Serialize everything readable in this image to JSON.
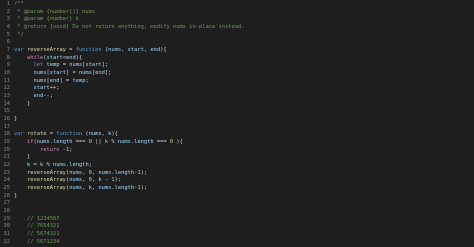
{
  "editor": {
    "lines": [
      {
        "n": "1",
        "tokens": [
          {
            "t": "/**",
            "c": "c"
          }
        ]
      },
      {
        "n": "2",
        "tokens": [
          {
            "t": " * @param {number[]} nums",
            "c": "c"
          }
        ]
      },
      {
        "n": "3",
        "tokens": [
          {
            "t": " * @param {number} k",
            "c": "c"
          }
        ]
      },
      {
        "n": "4",
        "tokens": [
          {
            "t": " * @return {void} Do not return anything, modify nums in-place instead.",
            "c": "c"
          }
        ]
      },
      {
        "n": "5",
        "tokens": [
          {
            "t": " */",
            "c": "c"
          }
        ]
      },
      {
        "n": "6",
        "tokens": []
      },
      {
        "n": "7",
        "tokens": [
          {
            "t": "var ",
            "c": "kw"
          },
          {
            "t": "reverseArray",
            "c": "fn"
          },
          {
            "t": " = ",
            "c": "op"
          },
          {
            "t": "function",
            "c": "kw"
          },
          {
            "t": " (",
            "c": "op"
          },
          {
            "t": "nums",
            "c": "va"
          },
          {
            "t": ", ",
            "c": "op"
          },
          {
            "t": "start",
            "c": "va"
          },
          {
            "t": ", ",
            "c": "op"
          },
          {
            "t": "end",
            "c": "va"
          },
          {
            "t": "){",
            "c": "op"
          }
        ]
      },
      {
        "n": "8",
        "tokens": [
          {
            "t": "    ",
            "c": "op"
          },
          {
            "t": "while",
            "c": "pr"
          },
          {
            "t": "(",
            "c": "op"
          },
          {
            "t": "start",
            "c": "va"
          },
          {
            "t": "<",
            "c": "op"
          },
          {
            "t": "end",
            "c": "va"
          },
          {
            "t": "){",
            "c": "op"
          }
        ]
      },
      {
        "n": "9",
        "tokens": [
          {
            "t": "      ",
            "c": "op"
          },
          {
            "t": "let ",
            "c": "kw"
          },
          {
            "t": "temp",
            "c": "va"
          },
          {
            "t": " = ",
            "c": "op"
          },
          {
            "t": "nums",
            "c": "va"
          },
          {
            "t": "[",
            "c": "op"
          },
          {
            "t": "start",
            "c": "va"
          },
          {
            "t": "];",
            "c": "op"
          }
        ]
      },
      {
        "n": "10",
        "tokens": [
          {
            "t": "      ",
            "c": "op"
          },
          {
            "t": "nums",
            "c": "va"
          },
          {
            "t": "[",
            "c": "op"
          },
          {
            "t": "start",
            "c": "va"
          },
          {
            "t": "] = ",
            "c": "op"
          },
          {
            "t": "nums",
            "c": "va"
          },
          {
            "t": "[",
            "c": "op"
          },
          {
            "t": "end",
            "c": "va"
          },
          {
            "t": "];",
            "c": "op"
          }
        ]
      },
      {
        "n": "11",
        "tokens": [
          {
            "t": "      ",
            "c": "op"
          },
          {
            "t": "nums",
            "c": "va"
          },
          {
            "t": "[",
            "c": "op"
          },
          {
            "t": "end",
            "c": "va"
          },
          {
            "t": "] = ",
            "c": "op"
          },
          {
            "t": "temp",
            "c": "va"
          },
          {
            "t": ";",
            "c": "op"
          }
        ]
      },
      {
        "n": "12",
        "tokens": [
          {
            "t": "      ",
            "c": "op"
          },
          {
            "t": "start",
            "c": "va"
          },
          {
            "t": "++;",
            "c": "op"
          }
        ]
      },
      {
        "n": "13",
        "tokens": [
          {
            "t": "      ",
            "c": "op"
          },
          {
            "t": "end",
            "c": "va"
          },
          {
            "t": "--;",
            "c": "op"
          }
        ]
      },
      {
        "n": "14",
        "tokens": [
          {
            "t": "    }",
            "c": "op"
          }
        ]
      },
      {
        "n": "15",
        "tokens": []
      },
      {
        "n": "16",
        "tokens": [
          {
            "t": "}",
            "c": "op"
          }
        ]
      },
      {
        "n": "17",
        "tokens": []
      },
      {
        "n": "18",
        "tokens": [
          {
            "t": "var ",
            "c": "kw"
          },
          {
            "t": "rotate",
            "c": "fn"
          },
          {
            "t": " = ",
            "c": "op"
          },
          {
            "t": "function",
            "c": "kw"
          },
          {
            "t": " (",
            "c": "op"
          },
          {
            "t": "nums",
            "c": "va"
          },
          {
            "t": ", ",
            "c": "op"
          },
          {
            "t": "k",
            "c": "va"
          },
          {
            "t": "){",
            "c": "op"
          }
        ]
      },
      {
        "n": "19",
        "tokens": [
          {
            "t": "    ",
            "c": "op"
          },
          {
            "t": "if",
            "c": "pr"
          },
          {
            "t": "(",
            "c": "op"
          },
          {
            "t": "nums",
            "c": "va"
          },
          {
            "t": ".",
            "c": "op"
          },
          {
            "t": "length",
            "c": "va"
          },
          {
            "t": " === ",
            "c": "op"
          },
          {
            "t": "0",
            "c": "nu"
          },
          {
            "t": " || ",
            "c": "op"
          },
          {
            "t": "k",
            "c": "va"
          },
          {
            "t": " % ",
            "c": "op"
          },
          {
            "t": "nums",
            "c": "va"
          },
          {
            "t": ".",
            "c": "op"
          },
          {
            "t": "length",
            "c": "va"
          },
          {
            "t": " === ",
            "c": "op"
          },
          {
            "t": "0",
            "c": "nu"
          },
          {
            "t": " ){",
            "c": "op"
          }
        ]
      },
      {
        "n": "20",
        "tokens": [
          {
            "t": "        ",
            "c": "op"
          },
          {
            "t": "return",
            "c": "pr"
          },
          {
            "t": " -",
            "c": "op"
          },
          {
            "t": "1",
            "c": "nu"
          },
          {
            "t": ";",
            "c": "op"
          }
        ]
      },
      {
        "n": "21",
        "tokens": [
          {
            "t": "    }",
            "c": "op"
          }
        ]
      },
      {
        "n": "22",
        "tokens": [
          {
            "t": "    ",
            "c": "op"
          },
          {
            "t": "k",
            "c": "va"
          },
          {
            "t": " = ",
            "c": "op"
          },
          {
            "t": "k",
            "c": "va"
          },
          {
            "t": " % ",
            "c": "op"
          },
          {
            "t": "nums",
            "c": "va"
          },
          {
            "t": ".",
            "c": "op"
          },
          {
            "t": "length",
            "c": "va"
          },
          {
            "t": ";",
            "c": "op"
          }
        ]
      },
      {
        "n": "23",
        "tokens": [
          {
            "t": "    ",
            "c": "op"
          },
          {
            "t": "reverseArray",
            "c": "fn"
          },
          {
            "t": "(",
            "c": "op"
          },
          {
            "t": "nums",
            "c": "va"
          },
          {
            "t": ", ",
            "c": "op"
          },
          {
            "t": "0",
            "c": "nu"
          },
          {
            "t": ", ",
            "c": "op"
          },
          {
            "t": "nums",
            "c": "va"
          },
          {
            "t": ".",
            "c": "op"
          },
          {
            "t": "length",
            "c": "va"
          },
          {
            "t": "-",
            "c": "op"
          },
          {
            "t": "1",
            "c": "nu"
          },
          {
            "t": ");",
            "c": "op"
          }
        ]
      },
      {
        "n": "24",
        "tokens": [
          {
            "t": "    ",
            "c": "op"
          },
          {
            "t": "reverseArray",
            "c": "fn"
          },
          {
            "t": "(",
            "c": "op"
          },
          {
            "t": "nums",
            "c": "va"
          },
          {
            "t": ", ",
            "c": "op"
          },
          {
            "t": "0",
            "c": "nu"
          },
          {
            "t": ", ",
            "c": "op"
          },
          {
            "t": "k",
            "c": "va"
          },
          {
            "t": " - ",
            "c": "op"
          },
          {
            "t": "1",
            "c": "nu"
          },
          {
            "t": ");",
            "c": "op"
          }
        ]
      },
      {
        "n": "25",
        "tokens": [
          {
            "t": "    ",
            "c": "op"
          },
          {
            "t": "reverseArray",
            "c": "fn"
          },
          {
            "t": "(",
            "c": "op"
          },
          {
            "t": "nums",
            "c": "va"
          },
          {
            "t": ", ",
            "c": "op"
          },
          {
            "t": "k",
            "c": "va"
          },
          {
            "t": ", ",
            "c": "op"
          },
          {
            "t": "nums",
            "c": "va"
          },
          {
            "t": ".",
            "c": "op"
          },
          {
            "t": "length",
            "c": "va"
          },
          {
            "t": "-",
            "c": "op"
          },
          {
            "t": "1",
            "c": "nu"
          },
          {
            "t": ");",
            "c": "op"
          }
        ]
      },
      {
        "n": "26",
        "tokens": [
          {
            "t": "}",
            "c": "op"
          }
        ]
      },
      {
        "n": "27",
        "tokens": []
      },
      {
        "n": "28",
        "tokens": []
      },
      {
        "n": "29",
        "tokens": [
          {
            "t": "    // 1234567",
            "c": "c"
          }
        ]
      },
      {
        "n": "30",
        "tokens": [
          {
            "t": "    // 7654321",
            "c": "c"
          }
        ]
      },
      {
        "n": "31",
        "tokens": [
          {
            "t": "    // 5674321",
            "c": "c"
          }
        ]
      },
      {
        "n": "32",
        "tokens": [
          {
            "t": "    // 5671234",
            "c": "c"
          }
        ]
      }
    ]
  }
}
